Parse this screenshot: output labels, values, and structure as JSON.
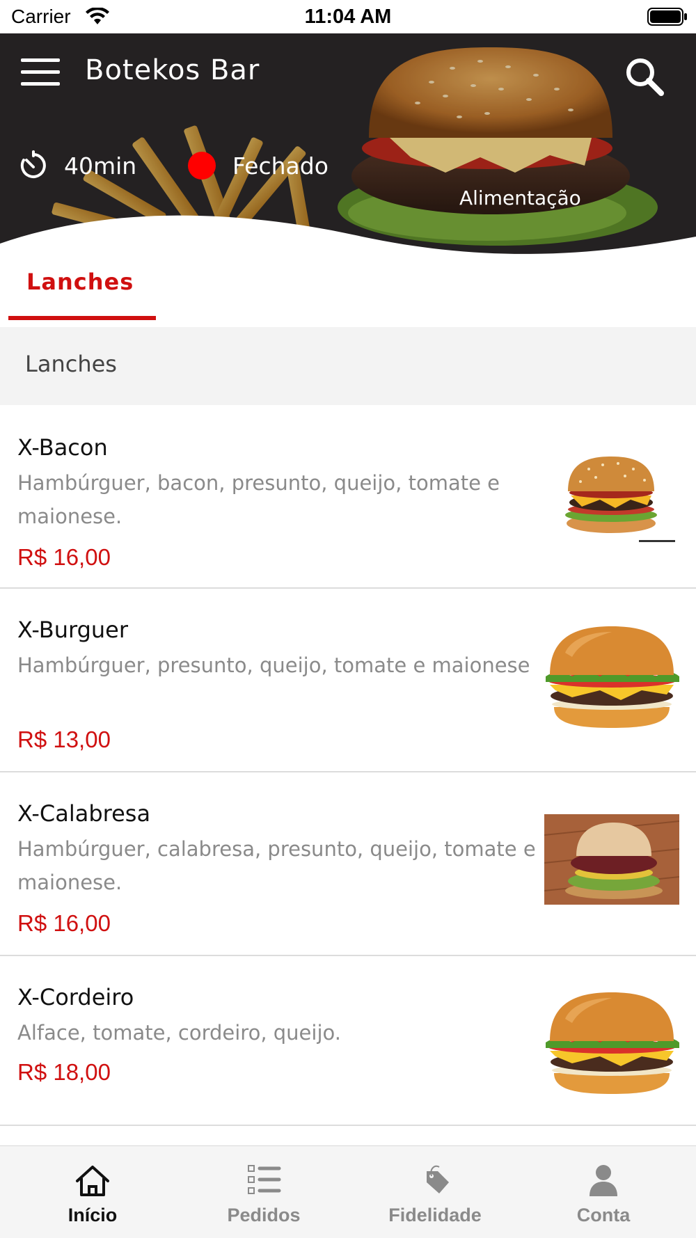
{
  "status_bar": {
    "carrier": "Carrier",
    "time": "11:04 AM"
  },
  "header": {
    "store_name": "Botekos Bar",
    "delivery_time": "40min",
    "open_status": "Fechado",
    "status_color": "#ff0000",
    "category": "Alimentação"
  },
  "tabs": [
    {
      "label": "Lanches",
      "active": true
    }
  ],
  "section": {
    "title": "Lanches"
  },
  "products": [
    {
      "name": "X-Bacon",
      "description": "Hambúrguer, bacon, presunto, queijo, tomate e maionese.",
      "price": "R$ 16,00",
      "image": "bacon-burger"
    },
    {
      "name": "X-Burguer",
      "description": "Hambúrguer, presunto, queijo, tomate e maionese",
      "price": "R$ 13,00",
      "image": "cheese-burger"
    },
    {
      "name": "X-Calabresa",
      "description": "Hambúrguer, calabresa, presunto, queijo, tomate e maionese.",
      "price": "R$ 16,00",
      "image": "calabresa-burger"
    },
    {
      "name": "X-Cordeiro",
      "description": "Alface, tomate, cordeiro, queijo.",
      "price": "R$ 18,00",
      "image": "cheese-burger"
    }
  ],
  "tab_bar": {
    "items": [
      {
        "label": "Início",
        "icon": "home-icon",
        "active": true
      },
      {
        "label": "Pedidos",
        "icon": "order-list-icon",
        "active": false
      },
      {
        "label": "Fidelidade",
        "icon": "loyalty-tag-icon",
        "active": false
      },
      {
        "label": "Conta",
        "icon": "person-icon",
        "active": false
      }
    ]
  },
  "colors": {
    "accent": "#d01010",
    "inactive": "#8a8a8a",
    "active_tab_text": "#111111"
  }
}
